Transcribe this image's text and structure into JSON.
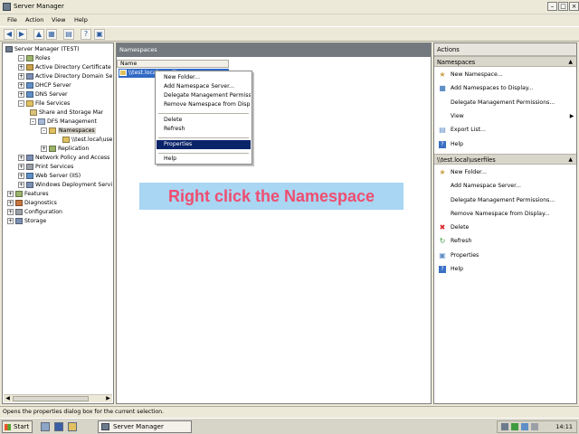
{
  "window": {
    "title": "Server Manager"
  },
  "menubar": {
    "file": "File",
    "action": "Action",
    "view": "View",
    "help": "Help"
  },
  "tree": {
    "items": [
      "Server Manager (TEST)",
      "Roles",
      "Active Directory Certificate",
      "Active Directory Domain Se",
      "DHCP Server",
      "DNS Server",
      "File Services",
      "Share and Storage Mar",
      "DFS Management",
      "Namespaces",
      "\\\\test.local\\use",
      "Replication",
      "Network Policy and Access",
      "Print Services",
      "Web Server (IIS)",
      "Windows Deployment Servi",
      "Features",
      "Diagnostics",
      "Configuration",
      "Storage"
    ]
  },
  "center": {
    "header": "Namespaces",
    "column_name": "Name",
    "selected_row": "\\\\test.local\\userfiles"
  },
  "context_menu": {
    "items": [
      "New Folder...",
      "Add Namespace Server...",
      "Delegate Management Permissions...",
      "Remove Namespace from Display...",
      "Delete",
      "Refresh",
      "Properties",
      "Help"
    ],
    "highlighted": "Properties"
  },
  "callout": "Right click the Namespace",
  "actions": {
    "title": "Actions",
    "section1": {
      "title": "Namespaces",
      "items": [
        "New Namespace...",
        "Add Namespaces to Display...",
        "Delegate Management Permissions...",
        "View",
        "Export List...",
        "Help"
      ]
    },
    "section2": {
      "title": "\\\\test.local\\userfiles",
      "items": [
        "New Folder...",
        "Add Namespace Server...",
        "Delegate Management Permissions...",
        "Remove Namespace from Display...",
        "Delete",
        "Refresh",
        "Properties",
        "Help"
      ]
    }
  },
  "status": "Opens the properties dialog box for the current selection.",
  "taskbar": {
    "start": "Start",
    "task": "Server Manager",
    "clock": "14:11"
  }
}
